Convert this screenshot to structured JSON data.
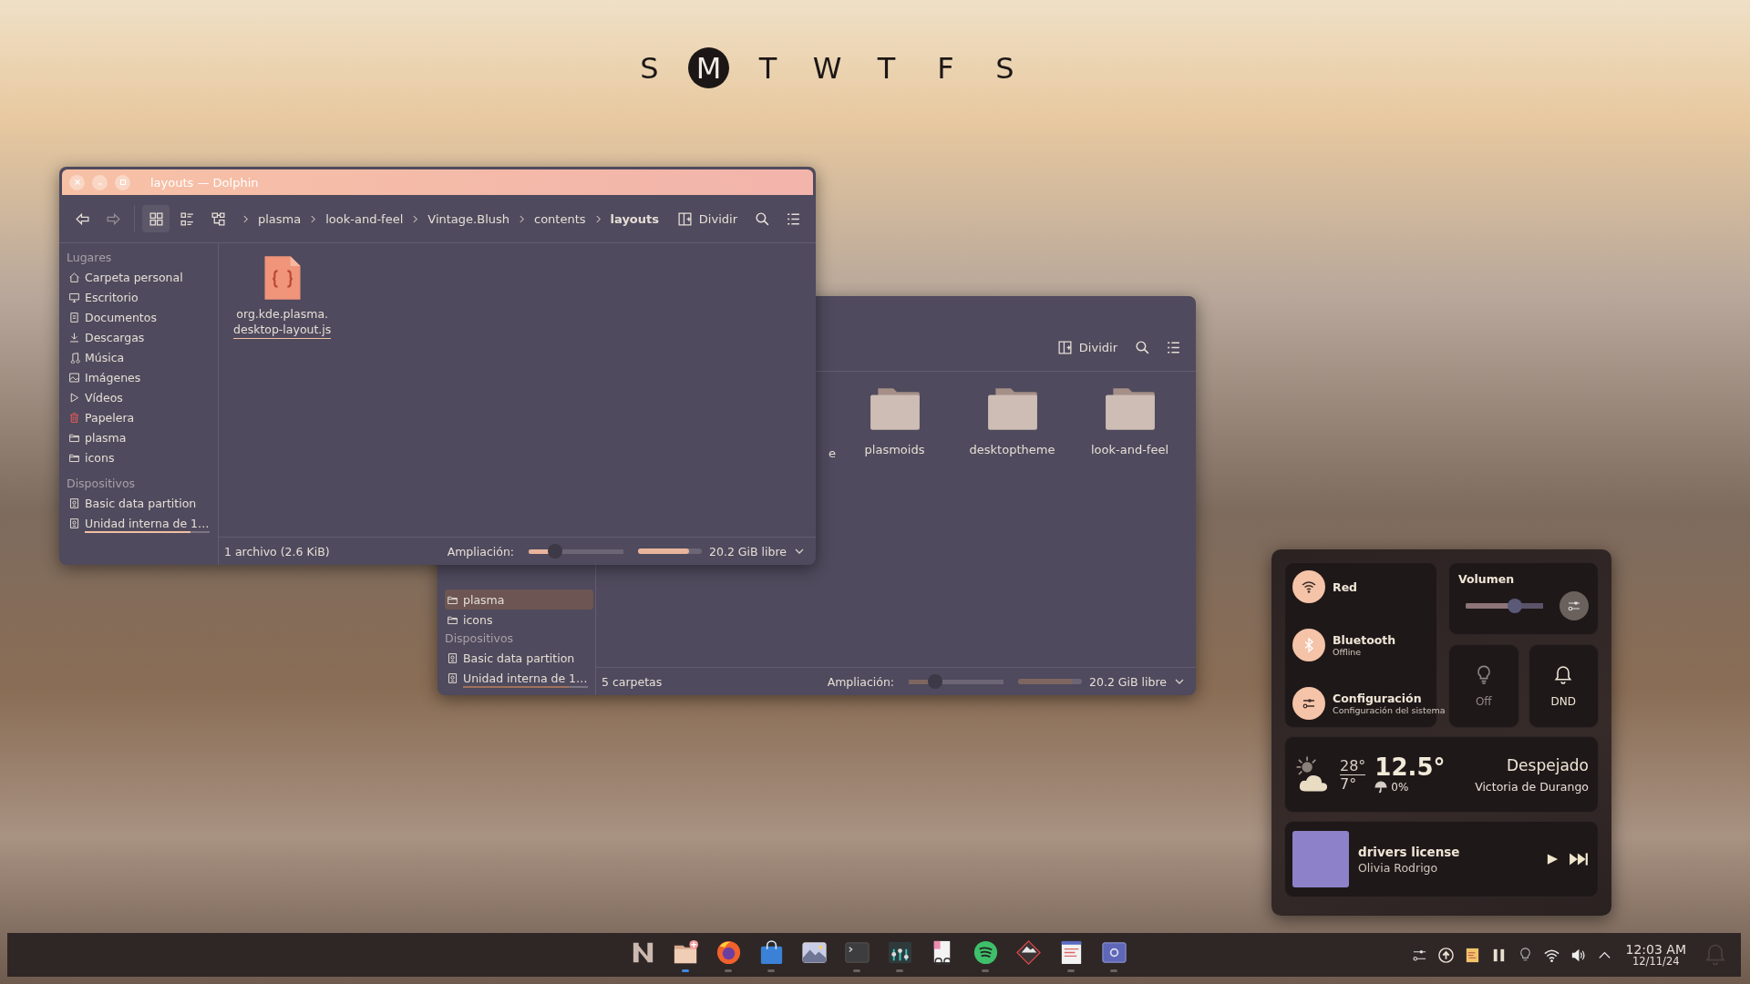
{
  "weekdays": [
    {
      "label": "S",
      "selected": false
    },
    {
      "label": "M",
      "selected": true
    },
    {
      "label": "T",
      "selected": false
    },
    {
      "label": "W",
      "selected": false
    },
    {
      "label": "T",
      "selected": false
    },
    {
      "label": "F",
      "selected": false
    },
    {
      "label": "S",
      "selected": false
    }
  ],
  "back_window": {
    "split_label": "Dividir",
    "cut_item_label": "e",
    "folders": [
      {
        "name": "plasmoids"
      },
      {
        "name": "desktoptheme"
      },
      {
        "name": "look-and-feel"
      }
    ],
    "places": [
      {
        "label": "plasma",
        "kind": "folder",
        "selected": true
      },
      {
        "label": "icons",
        "kind": "folder",
        "selected": false
      }
    ],
    "devices_heading": "Dispositivos",
    "devices": [
      {
        "label": "Basic data partition",
        "kind": "drive",
        "selected": false
      },
      {
        "label": "Unidad interna de 1…",
        "kind": "drive",
        "selected": false,
        "level": 0.85
      }
    ],
    "status": "5 carpetas",
    "zoom_label": "Ampliación:",
    "zoom": {
      "level": 0.28
    },
    "space": {
      "level": 0.85
    },
    "free_space": "20.2 GiB libre"
  },
  "front_window": {
    "title": "layouts — Dolphin",
    "back_disabled": false,
    "forward_disabled": true,
    "view_modes": [
      {
        "kind": "icons",
        "selected": true
      },
      {
        "kind": "details",
        "selected": false
      },
      {
        "kind": "tree",
        "selected": false
      }
    ],
    "breadcrumb": [
      {
        "label": "plasma",
        "selected": false
      },
      {
        "label": "look-and-feel",
        "selected": false
      },
      {
        "label": "Vintage.Blush",
        "selected": false
      },
      {
        "label": "contents",
        "selected": false
      },
      {
        "label": "layouts",
        "selected": true
      }
    ],
    "split_label": "Dividir",
    "places_heading": "Lugares",
    "places": [
      {
        "label": "Carpeta personal",
        "kind": "home",
        "selected": false
      },
      {
        "label": "Escritorio",
        "kind": "desktop",
        "selected": false
      },
      {
        "label": "Documentos",
        "kind": "documents",
        "selected": false
      },
      {
        "label": "Descargas",
        "kind": "downloads",
        "selected": false
      },
      {
        "label": "Música",
        "kind": "music",
        "selected": false
      },
      {
        "label": "Imágenes",
        "kind": "pictures",
        "selected": false
      },
      {
        "label": "Vídeos",
        "kind": "videos",
        "selected": false
      },
      {
        "label": "Papelera",
        "kind": "trash",
        "selected": false
      },
      {
        "label": "plasma",
        "kind": "folder",
        "selected": false
      },
      {
        "label": "icons",
        "kind": "folder",
        "selected": false
      }
    ],
    "devices_heading": "Dispositivos",
    "devices": [
      {
        "label": "Basic data partition",
        "kind": "drive",
        "selected": false
      },
      {
        "label": "Unidad interna de 1…",
        "kind": "drive",
        "selected": false,
        "level": 0.85
      }
    ],
    "files": [
      {
        "name_lines": [
          "org.kde.plasma.",
          "desktop-layout.js"
        ],
        "selected": true
      }
    ],
    "status": "1 archivo (2.6 KiB)",
    "zoom_label": "Ampliación:",
    "zoom": {
      "level": 0.28
    },
    "space": {
      "level": 0.8
    },
    "free_space": "20.2 GiB libre"
  },
  "control_panel": {
    "tiles": [
      {
        "kind": "network",
        "title": "Red"
      },
      {
        "kind": "bluetooth",
        "title": "Bluetooth",
        "subtitle": "Offline"
      },
      {
        "kind": "settings",
        "title": "Configuración",
        "subtitle": "Configuración del sistema"
      }
    ],
    "volume": {
      "label": "Volumen",
      "level": 0.63
    },
    "toggles": [
      {
        "kind": "bulb",
        "label": "Off",
        "on": false
      },
      {
        "kind": "bell",
        "label": "DND",
        "on": true
      }
    ],
    "weather": {
      "high": "28°",
      "low": "7°",
      "temperature": "12.5°",
      "precipitation": "0%",
      "condition": "Despejado",
      "location": "Victoria de Durango"
    },
    "media": {
      "title": "drivers license",
      "artist": "Olivia Rodrigo"
    }
  },
  "taskbar": {
    "apps": [
      {
        "kind": "launcher",
        "selected": false,
        "running": false
      },
      {
        "kind": "files",
        "selected": true,
        "running": true
      },
      {
        "kind": "browser",
        "selected": false,
        "running": true
      },
      {
        "kind": "store",
        "selected": false,
        "running": true
      },
      {
        "kind": "images",
        "selected": false,
        "running": false
      },
      {
        "kind": "terminal",
        "selected": false,
        "running": true
      },
      {
        "kind": "mixer",
        "selected": false,
        "running": true
      },
      {
        "kind": "reader",
        "selected": false,
        "running": false
      },
      {
        "kind": "music",
        "selected": false,
        "running": true
      },
      {
        "kind": "drawing",
        "selected": false,
        "running": false
      },
      {
        "kind": "editor",
        "selected": false,
        "running": true
      },
      {
        "kind": "capture",
        "selected": false,
        "running": true
      }
    ],
    "tray": [
      {
        "kind": "sliders"
      },
      {
        "kind": "update"
      },
      {
        "kind": "notes"
      },
      {
        "kind": "pause"
      },
      {
        "kind": "bulb"
      },
      {
        "kind": "wifi"
      },
      {
        "kind": "speaker"
      },
      {
        "kind": "expand"
      }
    ],
    "time": "12:03 AM",
    "date": "12/11/24"
  }
}
